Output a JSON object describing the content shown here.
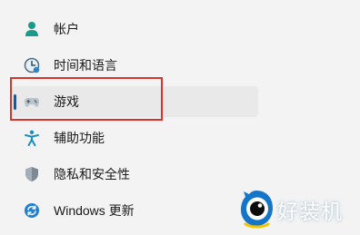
{
  "nav": {
    "items": [
      {
        "label": "帐户",
        "icon": "account-icon"
      },
      {
        "label": "时间和语言",
        "icon": "time-language-icon"
      },
      {
        "label": "游戏",
        "icon": "gamepad-icon",
        "selected": true
      },
      {
        "label": "辅助功能",
        "icon": "accessibility-icon"
      },
      {
        "label": "隐私和安全性",
        "icon": "shield-icon"
      },
      {
        "label": "Windows 更新",
        "icon": "windows-update-icon"
      }
    ]
  },
  "colors": {
    "accent": "#005fb8",
    "highlight_border": "#d9342b",
    "selected_bg": "#e9e9e9",
    "background": "#f3f3f3"
  },
  "watermark": {
    "text": "好装机"
  }
}
